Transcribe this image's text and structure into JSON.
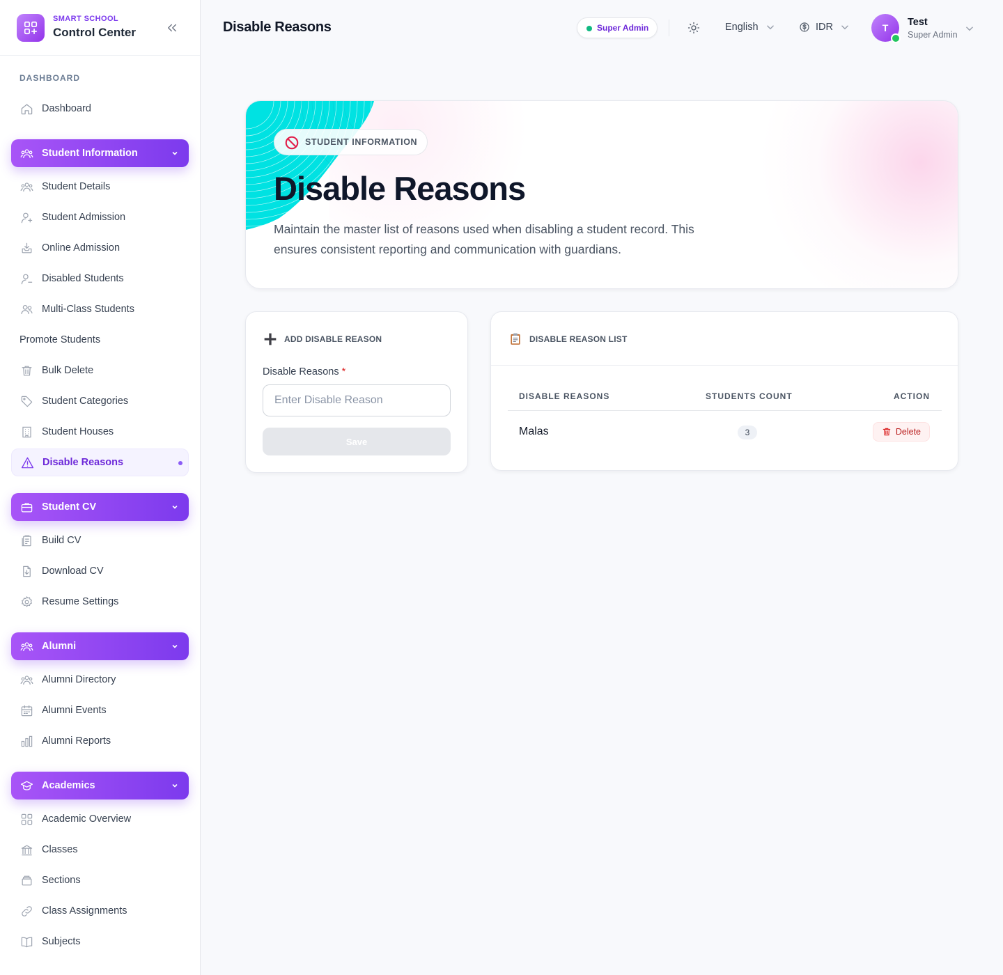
{
  "brand": {
    "subtitle": "SMART SCHOOL",
    "title": "Control Center"
  },
  "sidebar": {
    "section_label": "DASHBOARD",
    "dashboard": "Dashboard",
    "groups": {
      "student_information": "Student Information",
      "student_cv": "Student CV",
      "alumni": "Alumni",
      "academics": "Academics"
    },
    "items": {
      "student_details": "Student Details",
      "student_admission": "Student Admission",
      "online_admission": "Online Admission",
      "disabled_students": "Disabled Students",
      "multi_class_students": "Multi-Class Students",
      "promote_students": "Promote Students",
      "bulk_delete": "Bulk Delete",
      "student_categories": "Student Categories",
      "student_houses": "Student Houses",
      "disable_reasons": "Disable Reasons",
      "build_cv": "Build CV",
      "download_cv": "Download CV",
      "resume_settings": "Resume Settings",
      "alumni_directory": "Alumni Directory",
      "alumni_events": "Alumni Events",
      "alumni_reports": "Alumni Reports",
      "academic_overview": "Academic Overview",
      "classes": "Classes",
      "sections": "Sections",
      "class_assignments": "Class Assignments",
      "subjects": "Subjects"
    }
  },
  "header": {
    "title": "Disable Reasons",
    "role_badge": "Super Admin",
    "language": "English",
    "currency": "IDR",
    "user": {
      "initial": "T",
      "name": "Test",
      "role": "Super Admin"
    }
  },
  "hero": {
    "pill": "STUDENT INFORMATION",
    "title": "Disable Reasons",
    "description": "Maintain the master list of reasons used when disabling a student record. This ensures consistent reporting and communication with guardians."
  },
  "add_form": {
    "heading": "ADD DISABLE REASON",
    "field_label": "Disable Reasons",
    "required_mark": "*",
    "placeholder": "Enter Disable Reason",
    "value": "",
    "save_label": "Save"
  },
  "list": {
    "heading": "DISABLE REASON LIST",
    "columns": [
      "DISABLE REASONS",
      "STUDENTS COUNT",
      "ACTION"
    ],
    "rows": [
      {
        "reason": "Malas",
        "count": "3",
        "action": "Delete"
      }
    ]
  },
  "colors": {
    "accent": "#7c3aed",
    "accent_light": "#a855f7",
    "online": "#22c55e",
    "danger": "#b91c1c",
    "hero_cyan": "#00e0e0"
  }
}
